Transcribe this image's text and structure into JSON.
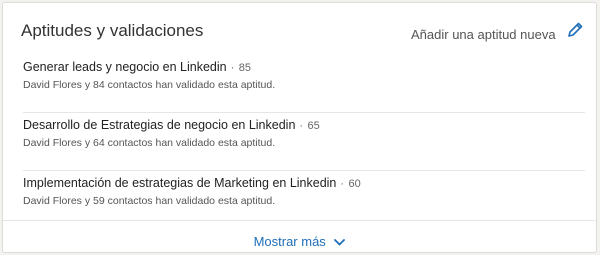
{
  "header": {
    "title": "Aptitudes y validaciones",
    "add_skill_label": "Añadir una aptitud nueva"
  },
  "skills": [
    {
      "name": "Generar leads y negocio en Linkedin",
      "separator": "·",
      "count": "85",
      "endorsement": "David Flores y 84 contactos han validado esta aptitud."
    },
    {
      "name": "Desarrollo de Estrategias de negocio en Linkedin",
      "separator": "·",
      "count": "65",
      "endorsement": "David Flores y 64 contactos han validado esta aptitud."
    },
    {
      "name": "Implementación de estrategias de Marketing en Linkedin",
      "separator": "·",
      "count": "60",
      "endorsement": "David Flores y 59 contactos han validado esta aptitud."
    }
  ],
  "footer": {
    "show_more_label": "Mostrar más"
  },
  "colors": {
    "accent": "#1f6fb8",
    "text": "#222222",
    "muted": "#666666"
  },
  "icons": {
    "edit": "pencil-icon",
    "expand": "chevron-down-icon"
  }
}
